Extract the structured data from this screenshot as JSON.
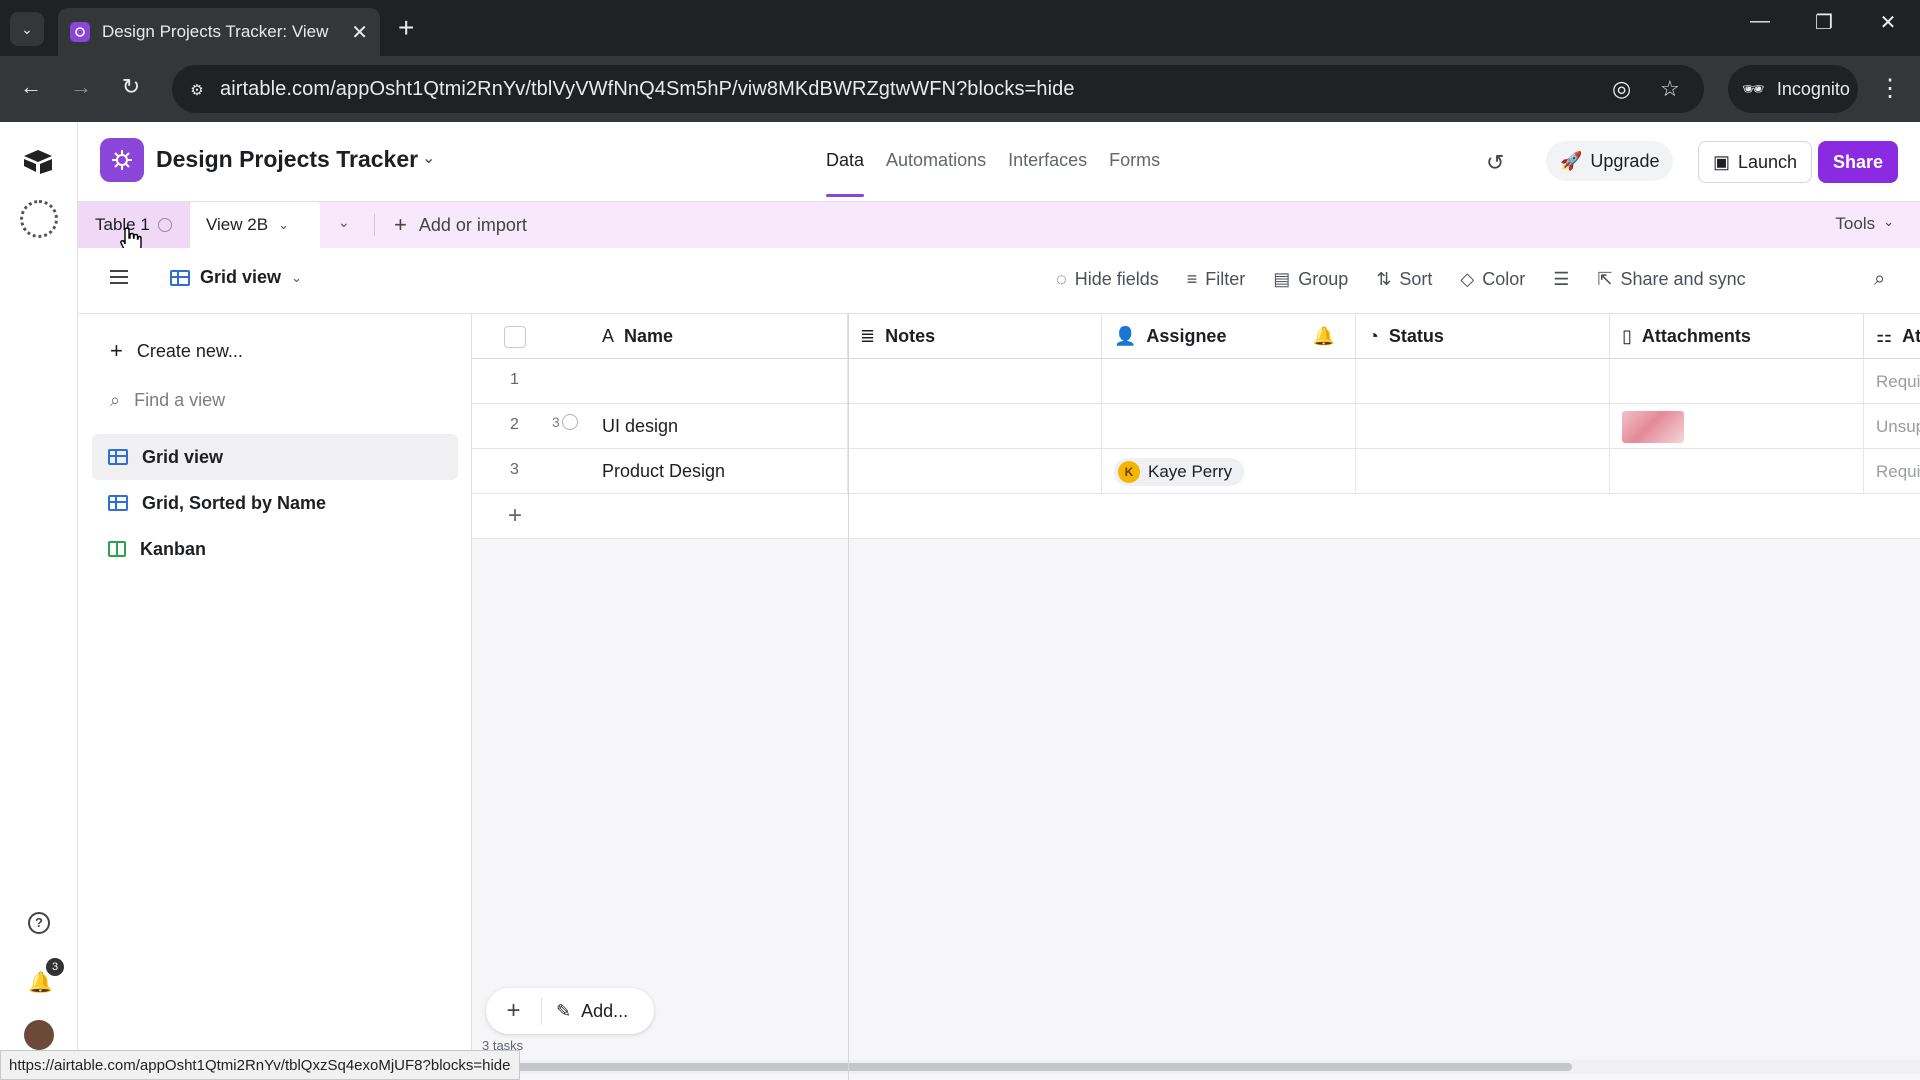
{
  "browser": {
    "tab_title": "Design Projects Tracker: View 2B",
    "url": "airtable.com/appOsht1Qtmi2RnYv/tblVyVWfNnQ4Sm5hP/viw8MKdBWRZgtwWFN?blocks=hide",
    "incognito_label": "Incognito",
    "status_url": "https://airtable.com/appOsht1Qtmi2RnYv/tblQxzSq4exoMjUF8?blocks=hide"
  },
  "rail": {
    "notification_count": "3"
  },
  "header": {
    "base_name": "Design Projects Tracker",
    "nav": [
      "Data",
      "Automations",
      "Interfaces",
      "Forms"
    ],
    "upgrade_label": "Upgrade",
    "launch_label": "Launch",
    "share_label": "Share",
    "accent_color": "#8a46d8"
  },
  "table_tabs": {
    "table_name": "Table 1",
    "view_name": "View 2B",
    "add_label": "Add or import",
    "tools_label": "Tools"
  },
  "toolbar": {
    "view_switcher": "Grid view",
    "hide_fields": "Hide fields",
    "filter": "Filter",
    "group": "Group",
    "sort": "Sort",
    "color": "Color",
    "share_sync": "Share and sync"
  },
  "sidebar": {
    "create_new": "Create new...",
    "find_placeholder": "Find a view",
    "views": [
      {
        "label": "Grid view",
        "icon": "grid-icon"
      },
      {
        "label": "Grid, Sorted by Name",
        "icon": "grid-icon"
      },
      {
        "label": "Kanban",
        "icon": "kanban-icon"
      }
    ]
  },
  "grid": {
    "columns": [
      "Name",
      "Notes",
      "Assignee",
      "Status",
      "Attachments",
      "Att"
    ],
    "rows": [
      {
        "num": "1",
        "name": "",
        "comments": "",
        "assignee": "",
        "assignee_initial": "",
        "last": "Requir"
      },
      {
        "num": "2",
        "name": "UI design",
        "comments": "3",
        "assignee": "",
        "assignee_initial": "",
        "last": "Unsup"
      },
      {
        "num": "3",
        "name": "Product Design",
        "comments": "",
        "assignee": "Kaye Perry",
        "assignee_initial": "K",
        "last": "Requir"
      }
    ],
    "add_label": "Add...",
    "records_label": "3 tasks"
  }
}
